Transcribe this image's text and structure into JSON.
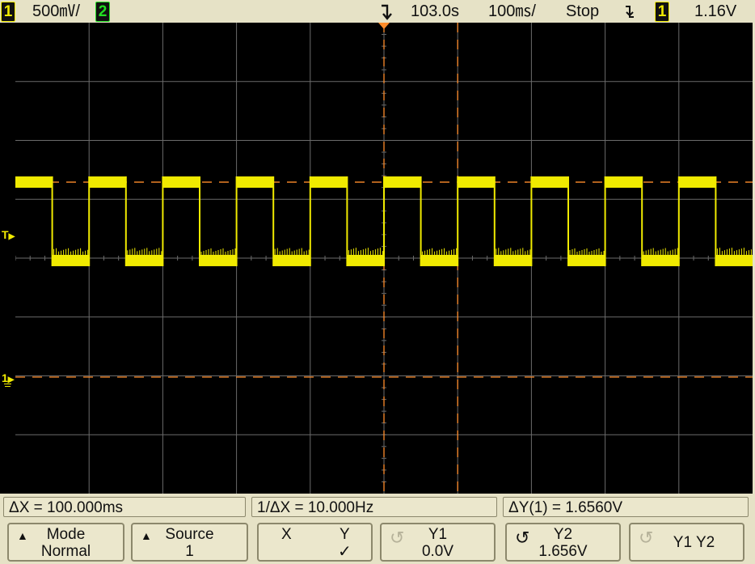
{
  "topbar": {
    "ch1_label": "1",
    "ch1_scale": "500㎷/",
    "ch2_label": "2",
    "trigger_icon": "trigger-arrow-icon",
    "time_offset": "103.0s",
    "time_scale": "100㎳/",
    "run_state": "Stop",
    "trigger_slope_icon": "falling-edge-icon",
    "trigger_source": "1",
    "trigger_level": "1.16V"
  },
  "left_markers": {
    "trigger_level_marker": "T",
    "ch1_ground_marker": "1"
  },
  "measurements": {
    "delta_x": "ΔX = 100.000ms",
    "inv_delta_x": "1/ΔX = 10.000Hz",
    "delta_y": "ΔY(1) = 1.6560V"
  },
  "softkeys": {
    "mode_title": "Mode",
    "mode_value": "Normal",
    "source_title": "Source",
    "source_value": "1",
    "x_label": "X",
    "y_label": "Y",
    "y_check": "✓",
    "y1_title": "Y1",
    "y1_value": "0.0V",
    "y2_title": "Y2",
    "y2_value": "1.656V",
    "y1y2_label": "Y1 Y2"
  },
  "colors": {
    "trace": "#f0ea00",
    "cursor": "#ff8c2a",
    "grid": "#6b6b6b",
    "ch2": "#22e022"
  },
  "waveform": {
    "type": "square",
    "frequency_hz": 10,
    "high_v": 1.656,
    "low_v": 0.0,
    "time_per_div_ms": 100,
    "volts_per_div_mv": 500
  }
}
